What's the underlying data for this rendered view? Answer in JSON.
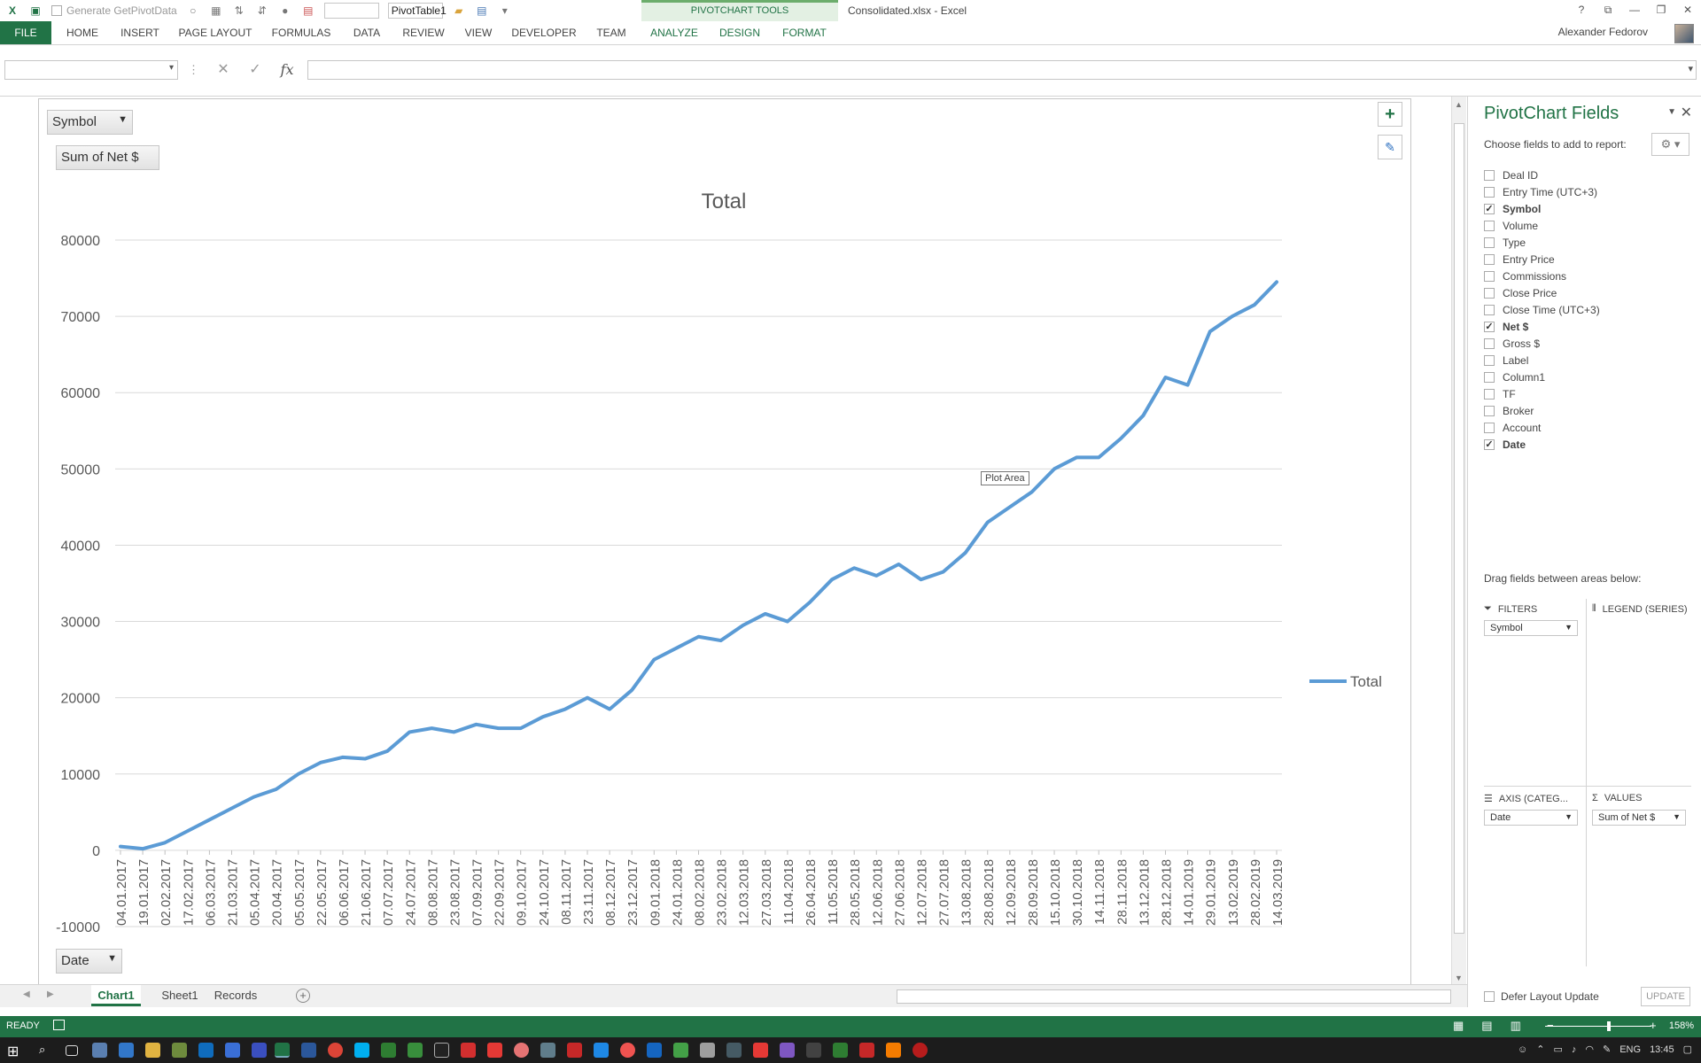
{
  "window": {
    "doc_title": "Consolidated.xlsx - Excel",
    "qat_checkbox_label": "Generate GetPivotData",
    "pivot_name": "PivotTable1",
    "controls": [
      "?",
      "⧉",
      "—",
      "❐",
      "✕"
    ],
    "user_name": "Alexander Fedorov"
  },
  "ribbon": {
    "context_label": "PIVOTCHART TOOLS",
    "tabs": [
      "FILE",
      "HOME",
      "INSERT",
      "PAGE LAYOUT",
      "FORMULAS",
      "DATA",
      "REVIEW",
      "VIEW",
      "DEVELOPER",
      "TEAM",
      "ANALYZE",
      "DESIGN",
      "FORMAT"
    ]
  },
  "formula_bar": {
    "name_box": "",
    "formula": "",
    "fx": "fx"
  },
  "pivot_buttons": {
    "filter": "Symbol",
    "value": "Sum of Net $",
    "axis": "Date"
  },
  "chart_data": {
    "type": "line",
    "title": "Total",
    "xlabel": "",
    "ylabel": "",
    "ylim": [
      -10000,
      80000
    ],
    "yticks": [
      80000,
      70000,
      60000,
      50000,
      40000,
      30000,
      20000,
      10000,
      0,
      -10000
    ],
    "legend": "right",
    "grid": true,
    "x": [
      "04.01.2017",
      "19.01.2017",
      "02.02.2017",
      "17.02.2017",
      "06.03.2017",
      "21.03.2017",
      "05.04.2017",
      "20.04.2017",
      "05.05.2017",
      "22.05.2017",
      "06.06.2017",
      "21.06.2017",
      "07.07.2017",
      "24.07.2017",
      "08.08.2017",
      "23.08.2017",
      "07.09.2017",
      "22.09.2017",
      "09.10.2017",
      "24.10.2017",
      "08.11.2017",
      "23.11.2017",
      "08.12.2017",
      "23.12.2017",
      "09.01.2018",
      "24.01.2018",
      "08.02.2018",
      "23.02.2018",
      "12.03.2018",
      "27.03.2018",
      "11.04.2018",
      "26.04.2018",
      "11.05.2018",
      "28.05.2018",
      "12.06.2018",
      "27.06.2018",
      "12.07.2018",
      "27.07.2018",
      "13.08.2018",
      "28.08.2018",
      "12.09.2018",
      "28.09.2018",
      "15.10.2018",
      "30.10.2018",
      "14.11.2018",
      "28.11.2018",
      "13.12.2018",
      "28.12.2018",
      "14.01.2019",
      "29.01.2019",
      "13.02.2019",
      "28.02.2019",
      "14.03.2019"
    ],
    "series": [
      {
        "name": "Total",
        "color": "#5b9bd5",
        "values": [
          500,
          200,
          1000,
          2500,
          4000,
          5500,
          7000,
          8000,
          10000,
          11500,
          12200,
          12000,
          13000,
          15500,
          16000,
          15500,
          16500,
          16000,
          16000,
          17500,
          18500,
          20000,
          18500,
          21000,
          25000,
          26500,
          28000,
          27500,
          29500,
          31000,
          30000,
          32500,
          35500,
          37000,
          36000,
          37500,
          35500,
          36500,
          39000,
          43000,
          45000,
          47000,
          50000,
          51500,
          51500,
          54000,
          57000,
          62000,
          61000,
          68000,
          70000,
          71500,
          74500
        ]
      }
    ]
  },
  "tooltip": "Plot Area",
  "pane": {
    "title": "PivotChart Fields",
    "subtitle": "Choose fields to add to report:",
    "fields": [
      {
        "label": "Deal ID",
        "checked": false
      },
      {
        "label": "Entry Time (UTC+3)",
        "checked": false
      },
      {
        "label": "Symbol",
        "checked": true
      },
      {
        "label": "Volume",
        "checked": false
      },
      {
        "label": "Type",
        "checked": false
      },
      {
        "label": "Entry Price",
        "checked": false
      },
      {
        "label": "Commissions",
        "checked": false
      },
      {
        "label": "Close Price",
        "checked": false
      },
      {
        "label": "Close Time (UTC+3)",
        "checked": false
      },
      {
        "label": "Net $",
        "checked": true
      },
      {
        "label": "Gross $",
        "checked": false
      },
      {
        "label": "Label",
        "checked": false
      },
      {
        "label": "Column1",
        "checked": false
      },
      {
        "label": "TF",
        "checked": false
      },
      {
        "label": "Broker",
        "checked": false
      },
      {
        "label": "Account",
        "checked": false
      },
      {
        "label": "Date",
        "checked": true
      }
    ],
    "drag_label": "Drag fields between areas below:",
    "areas": {
      "filters": {
        "label": "FILTERS",
        "value": "Symbol"
      },
      "legend": {
        "label": "LEGEND (SERIES)"
      },
      "axis": {
        "label": "AXIS (CATEG...",
        "value": "Date"
      },
      "values": {
        "label": "VALUES",
        "value": "Sum of Net $"
      }
    },
    "defer_label": "Defer Layout Update",
    "update_label": "UPDATE"
  },
  "sheets": {
    "tabs": [
      "Chart1",
      "Sheet1",
      "Records"
    ],
    "active": "Chart1"
  },
  "status": {
    "ready": "READY",
    "zoom": "158%"
  },
  "taskbar": {
    "lang": "ENG",
    "time": "13:45"
  }
}
